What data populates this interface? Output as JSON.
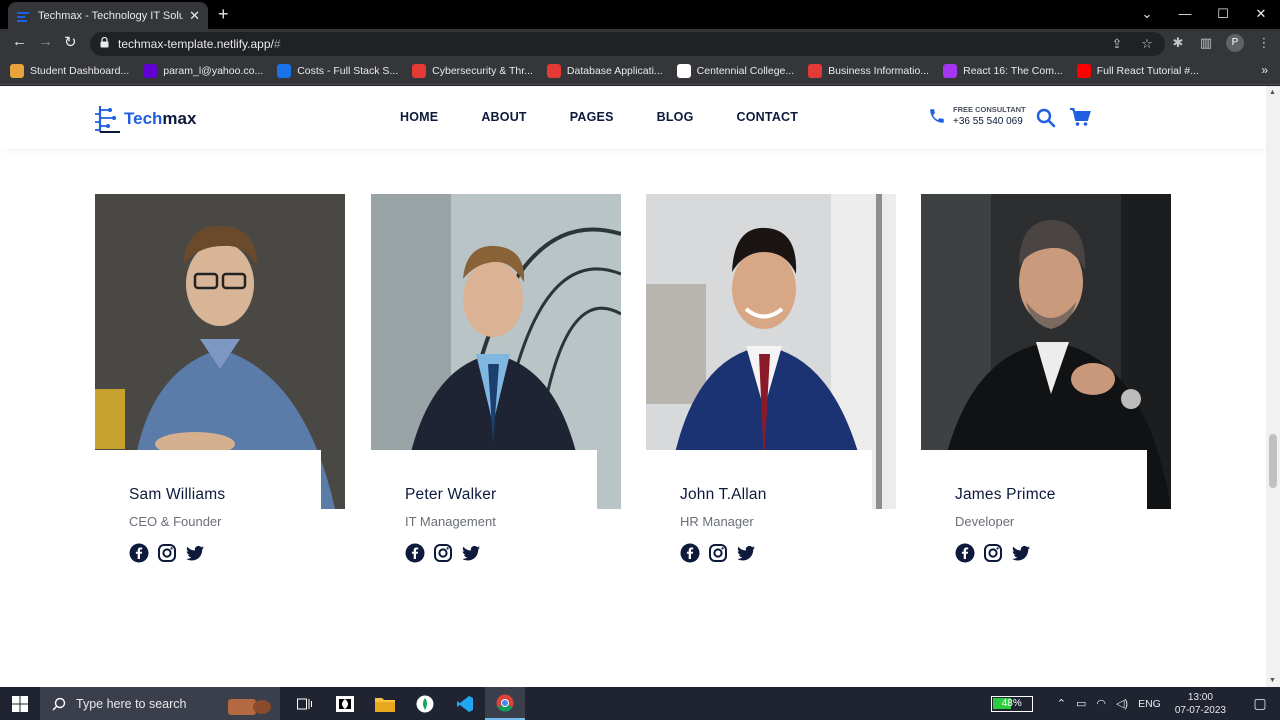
{
  "browser": {
    "tab_title": "Techmax - Technology IT Solution",
    "url_host": "techmax-template.netlify.app/",
    "url_hash": "#",
    "profile_initial": "P",
    "bookmarks": [
      {
        "label": "Student Dashboard...",
        "color": "#e8a33d"
      },
      {
        "label": "param_l@yahoo.co...",
        "color": "#6001d2"
      },
      {
        "label": "Costs - Full Stack S...",
        "color": "#1a73e8"
      },
      {
        "label": "Cybersecurity & Thr...",
        "color": "#e53935"
      },
      {
        "label": "Database Applicati...",
        "color": "#e53935"
      },
      {
        "label": "Centennial College...",
        "color": "#ffffff"
      },
      {
        "label": "Business Informatio...",
        "color": "#e53935"
      },
      {
        "label": "React 16: The Com...",
        "color": "#a435f0"
      },
      {
        "label": "Full React Tutorial #...",
        "color": "#ff0000"
      }
    ]
  },
  "header": {
    "logo_prefix": "Tech",
    "logo_suffix": "max",
    "nav": [
      "HOME",
      "ABOUT",
      "PAGES",
      "BLOG",
      "CONTACT"
    ],
    "consult_label": "FREE CONSULTANT",
    "consult_number": "+36 55 540 069"
  },
  "team": [
    {
      "name": "Sam Williams",
      "role": "CEO & Founder"
    },
    {
      "name": "Peter Walker",
      "role": "IT Management"
    },
    {
      "name": "John T.Allan",
      "role": "HR Manager"
    },
    {
      "name": "James Primce",
      "role": "Developer"
    }
  ],
  "taskbar": {
    "search_placeholder": "Type here to search",
    "battery": "48%",
    "battery_level": 0.48,
    "lang": "ENG",
    "time": "13:00",
    "date": "07-07-2023"
  },
  "colors": {
    "brand_blue": "#1f5fe0",
    "brand_navy": "#0d1a3c"
  }
}
